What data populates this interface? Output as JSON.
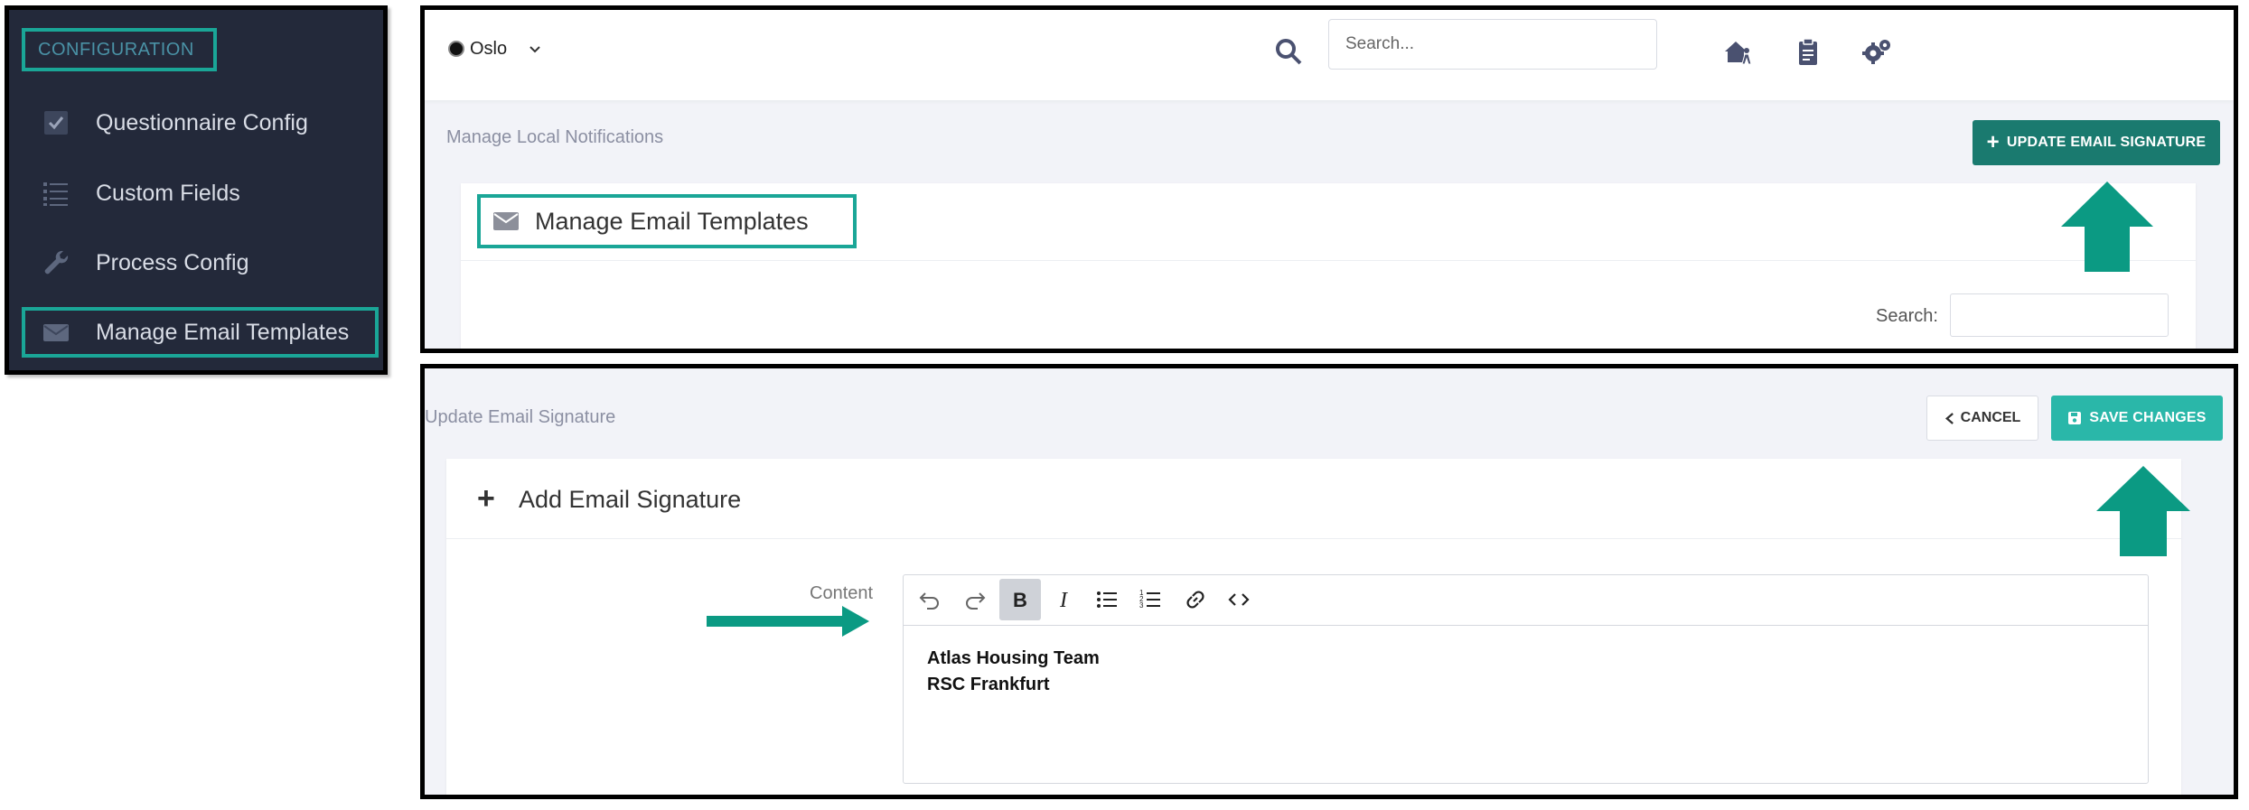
{
  "sidebar": {
    "section_header": "CONFIGURATION",
    "items": [
      {
        "label": "Questionnaire Config",
        "icon": "check-square-icon"
      },
      {
        "label": "Custom Fields",
        "icon": "list-icon"
      },
      {
        "label": "Process Config",
        "icon": "wrench-icon"
      },
      {
        "label": "Manage Email Templates",
        "icon": "envelope-icon"
      }
    ]
  },
  "topbar": {
    "org_name": "Oslo",
    "search_placeholder": "Search...",
    "icons": [
      "house-person-icon",
      "clipboard-icon",
      "gears-icon"
    ]
  },
  "notifications_page": {
    "breadcrumb": "Manage Local Notifications",
    "update_button_label": "UPDATE EMAIL SIGNATURE",
    "card_title": "Manage Email Templates",
    "search_label": "Search:"
  },
  "signature_page": {
    "breadcrumb": "Update Email Signature",
    "cancel_label": "CANCEL",
    "save_label": "SAVE CHANGES",
    "card_title": "Add Email Signature",
    "content_label": "Content",
    "content_lines": [
      "Atlas Housing Team",
      "RSC Frankfurt"
    ]
  },
  "colors": {
    "sidebar_bg": "#23293a",
    "highlight": "#1aa697",
    "primary_button": "#1a7a6f",
    "save_button": "#2ab7a9",
    "arrow": "#0b9a83"
  }
}
